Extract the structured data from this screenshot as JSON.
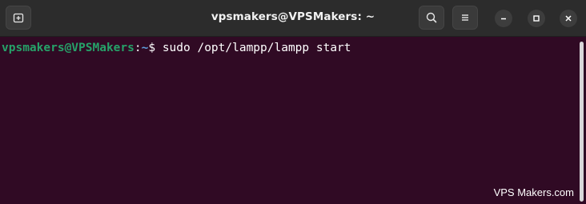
{
  "window": {
    "title": "vpsmakers@VPSMakers: ~"
  },
  "toolbar": {
    "new_tab_icon": "new-tab-icon",
    "search_icon": "search-icon",
    "menu_icon": "hamburger-menu-icon",
    "minimize_icon": "minimize-icon",
    "maximize_icon": "maximize-icon",
    "close_icon": "close-icon"
  },
  "terminal": {
    "user_host": "vpsmakers@VPSMakers",
    "separator": ":",
    "cwd": "~",
    "prompt_symbol": "$ ",
    "command": "sudo /opt/lampp/lampp start"
  },
  "watermark": "VPS Makers.com",
  "colors": {
    "terminal_background": "#300a24",
    "titlebar_background": "#2c2c2c",
    "prompt_user_color": "#26a269",
    "prompt_path_color": "#5f9fde"
  }
}
